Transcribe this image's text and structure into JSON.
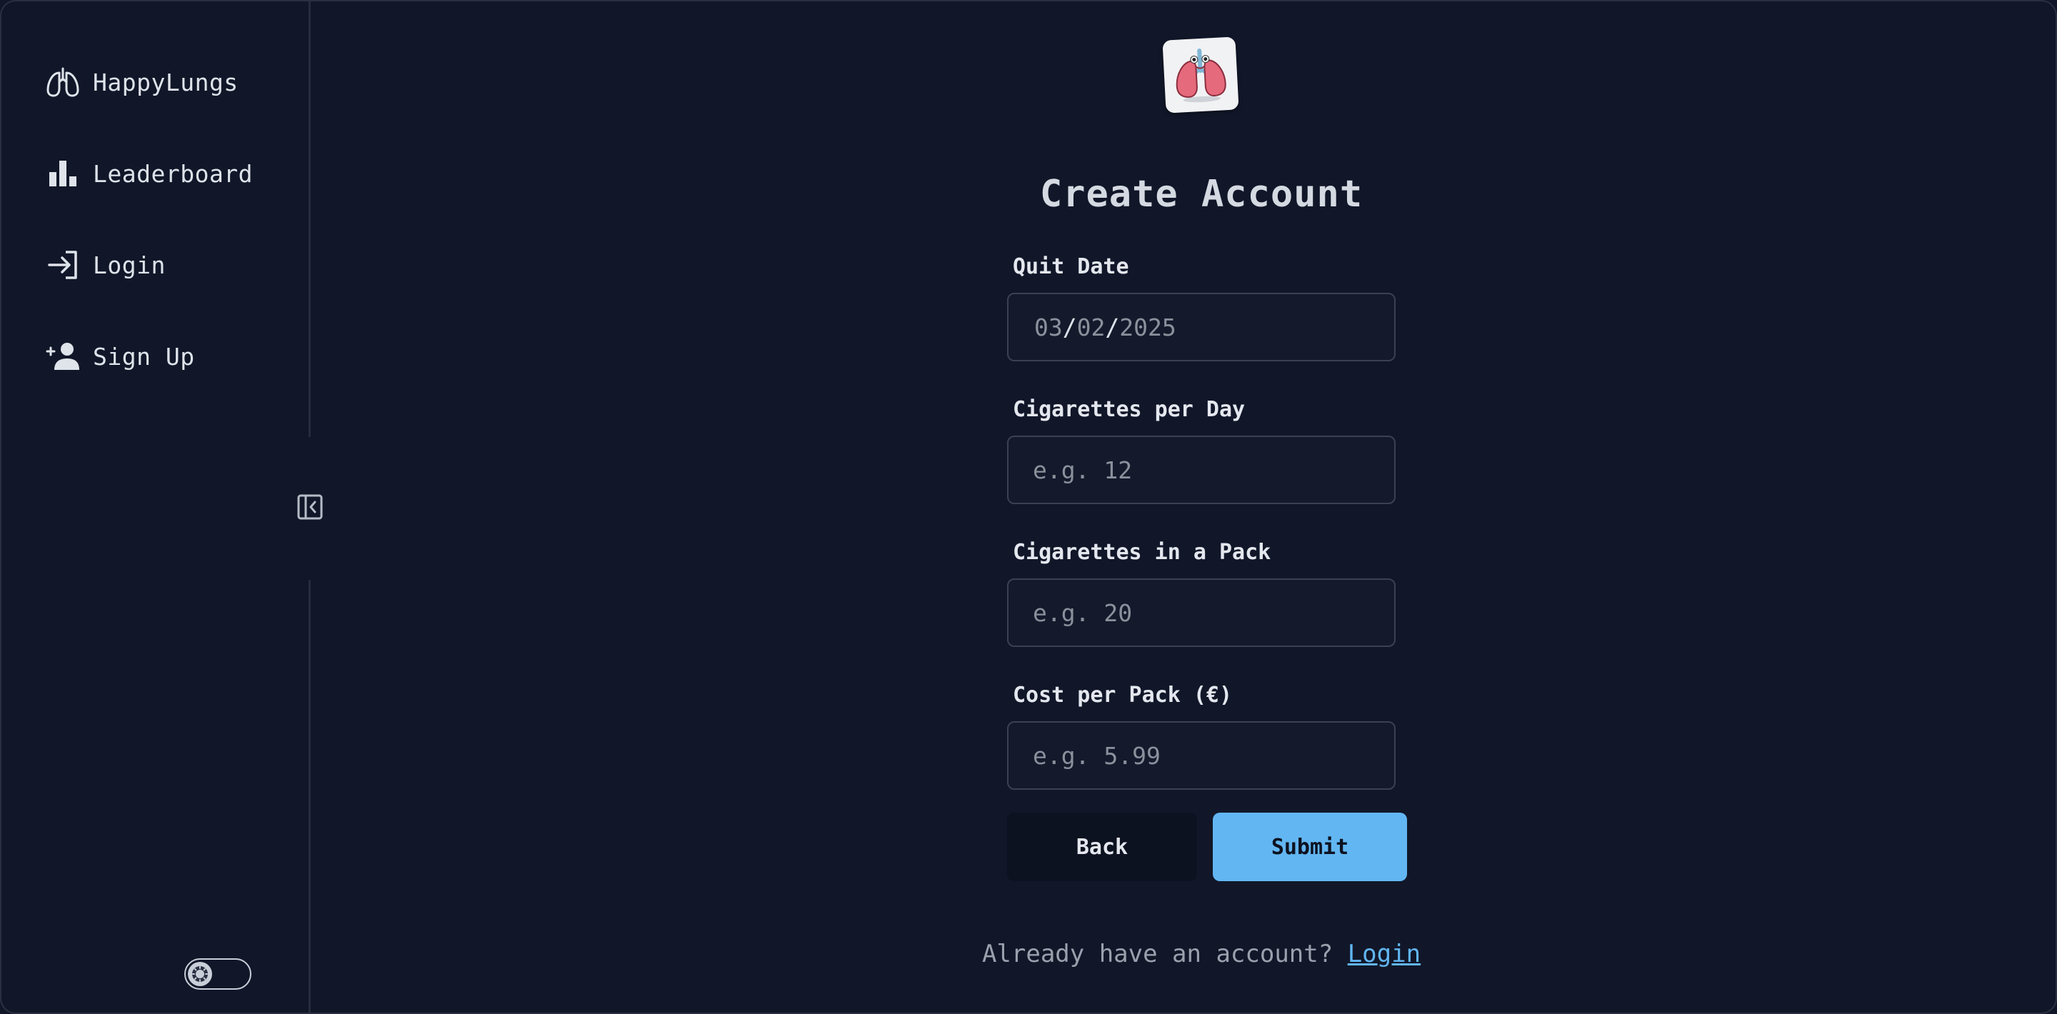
{
  "sidebar": {
    "items": [
      {
        "label": "HappyLungs",
        "icon": "lungs-icon"
      },
      {
        "label": "Leaderboard",
        "icon": "bar-chart-icon"
      },
      {
        "label": "Login",
        "icon": "login-icon"
      },
      {
        "label": "Sign Up",
        "icon": "add-user-icon"
      }
    ],
    "collapse_icon": "collapse-sidebar-icon",
    "theme_toggle_icon": "sun-icon"
  },
  "logo": {
    "icon": "lungs-mascot-logo"
  },
  "form": {
    "title": "Create Account",
    "fields": {
      "quit_date": {
        "label": "Quit Date",
        "month": "03",
        "day": "02",
        "year": "2025",
        "separator": "/"
      },
      "cigarettes_per_day": {
        "label": "Cigarettes per Day",
        "placeholder": "e.g. 12"
      },
      "cigarettes_in_pack": {
        "label": "Cigarettes in a Pack",
        "placeholder": "e.g. 20"
      },
      "cost_per_pack": {
        "label": "Cost per Pack (€)",
        "placeholder": "e.g. 5.99"
      }
    },
    "buttons": {
      "back": "Back",
      "submit": "Submit"
    },
    "footer": {
      "text": "Already have an account?",
      "link": "Login"
    }
  },
  "colors": {
    "background": "#111729",
    "accent": "#62b6f2",
    "input_border": "#3a4152",
    "back_button": "#0d1220"
  }
}
